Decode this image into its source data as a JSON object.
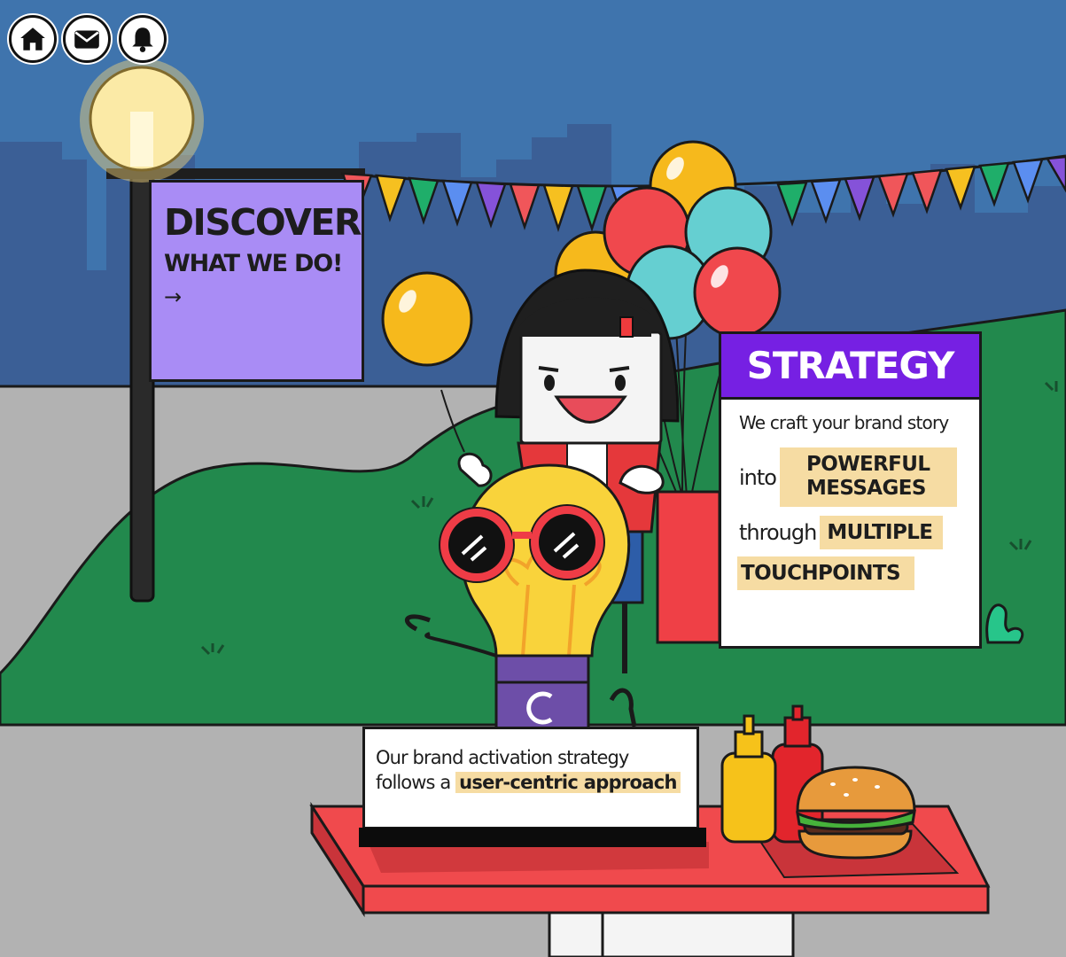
{
  "nav": {
    "home_icon": "home-icon",
    "mail_icon": "mail-icon",
    "bell_icon": "bell-icon"
  },
  "discover_sign": {
    "title": "DISCOVER",
    "subtitle": "WHAT WE DO!",
    "arrow": "→"
  },
  "strategy_board": {
    "title": "STRATEGY",
    "line1": "We craft your brand story",
    "into": "into",
    "highlight1_line1": "POWERFUL",
    "highlight1_line2": "MESSAGES",
    "through": "through",
    "highlight2": "MULTIPLE",
    "highlight3": "TOUCHPOINTS"
  },
  "info_card": {
    "line1": "Our brand activation strategy",
    "line2_prefix": "follows a",
    "line2_highlight": "user-centric approach"
  },
  "colors": {
    "sky": "#3f74ad",
    "skyline": "#3b5f96",
    "grass": "#22894d",
    "ground": "#b2b2b2",
    "sign": "#a98cf5",
    "board_header": "#7620e3",
    "highlight": "#f6dca3",
    "table": "#f04a4d"
  }
}
